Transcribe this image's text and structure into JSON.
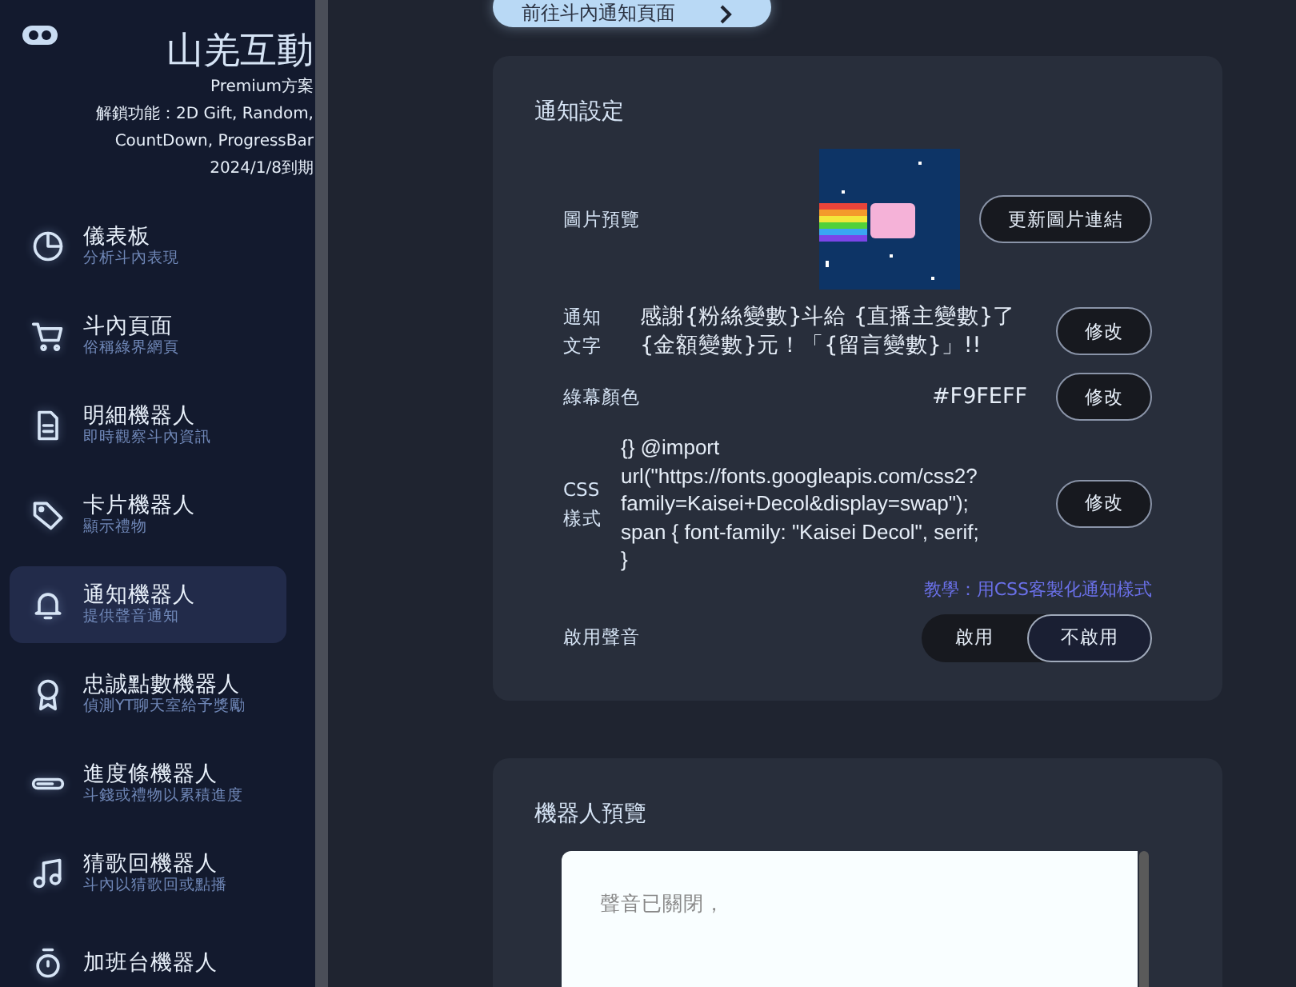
{
  "sidebar": {
    "brand": "山羌互動",
    "plan": "Premium方案",
    "features": "解鎖功能：2D Gift, Random, CountDown, ProgressBar",
    "expiry": "2024/1/8到期",
    "items": [
      {
        "title": "儀表板",
        "subtitle": "分析斗內表現",
        "selected": false
      },
      {
        "title": "斗內頁面",
        "subtitle": "俗稱綠界網頁",
        "selected": false
      },
      {
        "title": "明細機器人",
        "subtitle": "即時觀察斗內資訊",
        "selected": false
      },
      {
        "title": "卡片機器人",
        "subtitle": "顯示禮物",
        "selected": false
      },
      {
        "title": "通知機器人",
        "subtitle": "提供聲音通知",
        "selected": true
      },
      {
        "title": "忠誠點數機器人",
        "subtitle": "偵測YT聊天室給予獎勵",
        "selected": false
      },
      {
        "title": "進度條機器人",
        "subtitle": "斗錢或禮物以累積進度",
        "selected": false
      },
      {
        "title": "猜歌回機器人",
        "subtitle": "斗內以猜歌回或點播",
        "selected": false
      },
      {
        "title": "加班台機器人",
        "selected": false
      }
    ]
  },
  "top_link": {
    "label": "前往斗內通知頁面"
  },
  "settings": {
    "title": "通知設定",
    "rows": [
      {
        "label": "圖片預覽",
        "button": "更新圖片連結"
      },
      {
        "kind": "text",
        "label": "通知文字",
        "value": "感謝{粉絲變數}斗給 {直播主變數}了 {金額變數}元！「{留言變數}」!!",
        "button": "修改"
      },
      {
        "kind": "color",
        "label": "綠幕顏色",
        "value": "#F9FEFF",
        "button": "修改"
      },
      {
        "kind": "css",
        "label": "CSS樣式",
        "value": "{} @import\nurl(\"https://fonts.googleapis.com/css2?\nfamily=Kaisei+Decol&display=swap\");\nspan { font-family: \"Kaisei Decol\", serif;\n}",
        "button": "修改"
      },
      {
        "kind": "link",
        "label": "教學：用CSS客製化通知樣式"
      },
      {
        "kind": "toggle",
        "label": "啟用聲音",
        "options": [
          {
            "label": "啟用",
            "selected": false
          },
          {
            "label": "不啟用",
            "selected": true
          }
        ]
      }
    ]
  },
  "preview": {
    "title": "機器人預覽",
    "message": "聲音已關閉，"
  }
}
